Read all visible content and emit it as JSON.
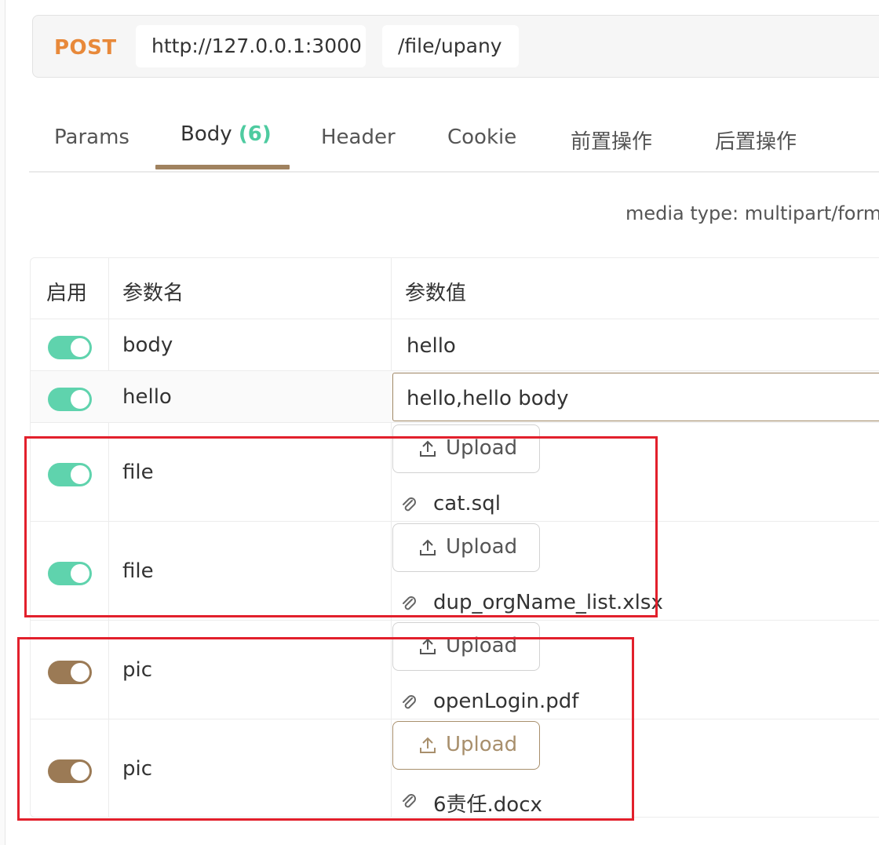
{
  "request": {
    "method": "POST",
    "base_url": "http://127.0.0.1:3000",
    "path": "/file/upany"
  },
  "tabs": [
    {
      "label": "Params"
    },
    {
      "label": "Body",
      "count": "(6)"
    },
    {
      "label": "Header"
    },
    {
      "label": "Cookie"
    },
    {
      "label": "前置操作"
    },
    {
      "label": "后置操作"
    }
  ],
  "active_tab": "Body",
  "media_type": "media type: multipart/form",
  "table": {
    "headers": {
      "enabled": "启用",
      "name": "参数名",
      "value": "参数值"
    },
    "rows": [
      {
        "enabled": true,
        "name": "body",
        "value": "hello",
        "type": "text"
      },
      {
        "enabled": true,
        "name": "hello",
        "value": "hello,hello body",
        "type": "text"
      },
      {
        "enabled": true,
        "name": "file",
        "upload_label": "Upload",
        "file_name": "cat.sql",
        "type": "file"
      },
      {
        "enabled": true,
        "name": "file",
        "upload_label": "Upload",
        "file_name": "dup_orgName_list.xlsx",
        "type": "file"
      },
      {
        "enabled": true,
        "name": "pic",
        "upload_label": "Upload",
        "file_name": "openLogin.pdf",
        "type": "file"
      },
      {
        "enabled": true,
        "name": "pic",
        "upload_label": "Upload",
        "file_name": "6责任.docx",
        "type": "file"
      }
    ]
  },
  "colors": {
    "method": "#e8893a",
    "toggle_green": "#5fd3ad",
    "toggle_brown": "#9b7a55",
    "accent": "#a0825f",
    "highlight_box": "#e2202c"
  }
}
